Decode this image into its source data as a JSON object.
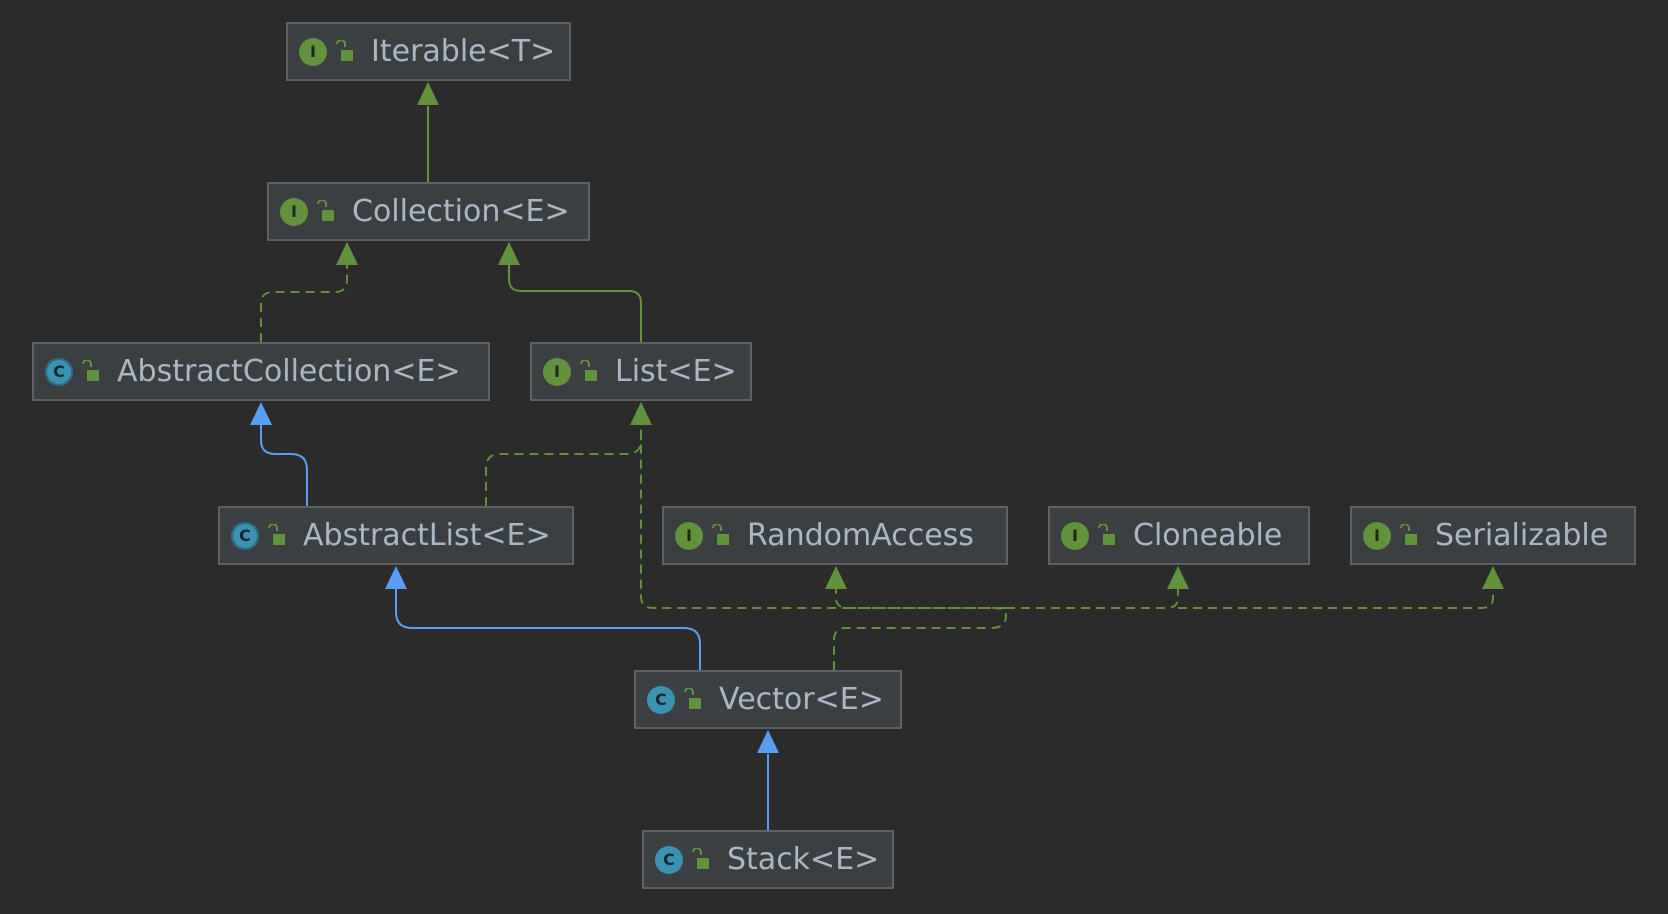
{
  "colors": {
    "background": "#2b2b2b",
    "node_fill": "#3c3f41",
    "node_border": "#5d6163",
    "text": "#a9b7c6",
    "interface_green": "#62923d",
    "class_blue": "#3a91b0",
    "extends_blue": "#589df6",
    "implements_green": "#62923d"
  },
  "nodes": [
    {
      "id": "iterable",
      "label": "Iterable<T>",
      "kind": "interface",
      "icon_letter": "I",
      "icon": "interface-icon"
    },
    {
      "id": "collection",
      "label": "Collection<E>",
      "kind": "interface",
      "icon_letter": "I",
      "icon": "interface-icon"
    },
    {
      "id": "abstractcollection",
      "label": "AbstractCollection<E>",
      "kind": "abstract",
      "icon_letter": "C",
      "icon": "abstract-class-icon"
    },
    {
      "id": "list",
      "label": "List<E>",
      "kind": "interface",
      "icon_letter": "I",
      "icon": "interface-icon"
    },
    {
      "id": "abstractlist",
      "label": "AbstractList<E>",
      "kind": "abstract",
      "icon_letter": "C",
      "icon": "abstract-class-icon"
    },
    {
      "id": "randomaccess",
      "label": "RandomAccess",
      "kind": "interface",
      "icon_letter": "I",
      "icon": "interface-icon"
    },
    {
      "id": "cloneable",
      "label": "Cloneable",
      "kind": "interface",
      "icon_letter": "I",
      "icon": "interface-icon"
    },
    {
      "id": "serializable",
      "label": "Serializable",
      "kind": "interface",
      "icon_letter": "I",
      "icon": "interface-icon"
    },
    {
      "id": "vector",
      "label": "Vector<E>",
      "kind": "class",
      "icon_letter": "C",
      "icon": "class-icon"
    },
    {
      "id": "stack",
      "label": "Stack<E>",
      "kind": "class",
      "icon_letter": "C",
      "icon": "class-icon"
    }
  ],
  "edges": [
    {
      "from": "collection",
      "to": "iterable",
      "relation": "extends-interface"
    },
    {
      "from": "abstractcollection",
      "to": "collection",
      "relation": "implements"
    },
    {
      "from": "list",
      "to": "collection",
      "relation": "extends-interface"
    },
    {
      "from": "abstractlist",
      "to": "abstractcollection",
      "relation": "extends-class"
    },
    {
      "from": "abstractlist",
      "to": "list",
      "relation": "implements"
    },
    {
      "from": "vector",
      "to": "abstractlist",
      "relation": "extends-class"
    },
    {
      "from": "vector",
      "to": "list",
      "relation": "implements"
    },
    {
      "from": "vector",
      "to": "randomaccess",
      "relation": "implements"
    },
    {
      "from": "vector",
      "to": "cloneable",
      "relation": "implements"
    },
    {
      "from": "vector",
      "to": "serializable",
      "relation": "implements"
    },
    {
      "from": "stack",
      "to": "vector",
      "relation": "extends-class"
    }
  ]
}
